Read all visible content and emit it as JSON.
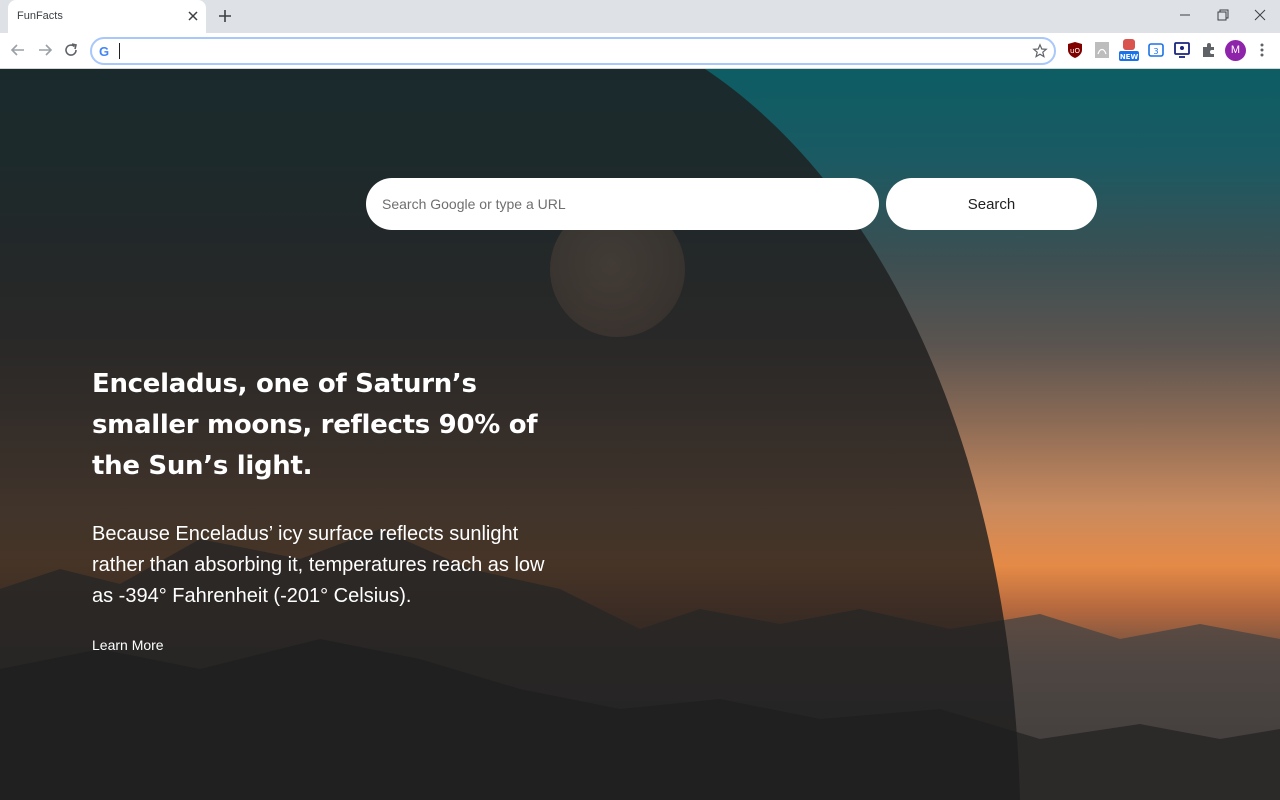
{
  "browser": {
    "tab_title": "FunFacts",
    "address_value": "",
    "avatar_letter": "M",
    "extensions": [
      "ublock-icon",
      "pdf-icon",
      "new-badge-icon",
      "translate-icon",
      "screen-icon",
      "puzzle-icon"
    ],
    "new_badge": "NEW"
  },
  "search": {
    "placeholder": "Search Google or type a URL",
    "button_label": "Search"
  },
  "fact": {
    "title": "Enceladus, one of Saturn’s smaller moons, reflects 90% of the Sun’s light.",
    "body": "Because Enceladus’ icy surface reflects sunlight rather than absorbing it, temperatures reach as low as -394° Fahrenheit (-201° Celsius).",
    "link_label": "Learn More"
  },
  "colors": {
    "accent": "#a8c7fa",
    "avatar": "#8e24aa",
    "overlay": "#1e1e1e"
  }
}
